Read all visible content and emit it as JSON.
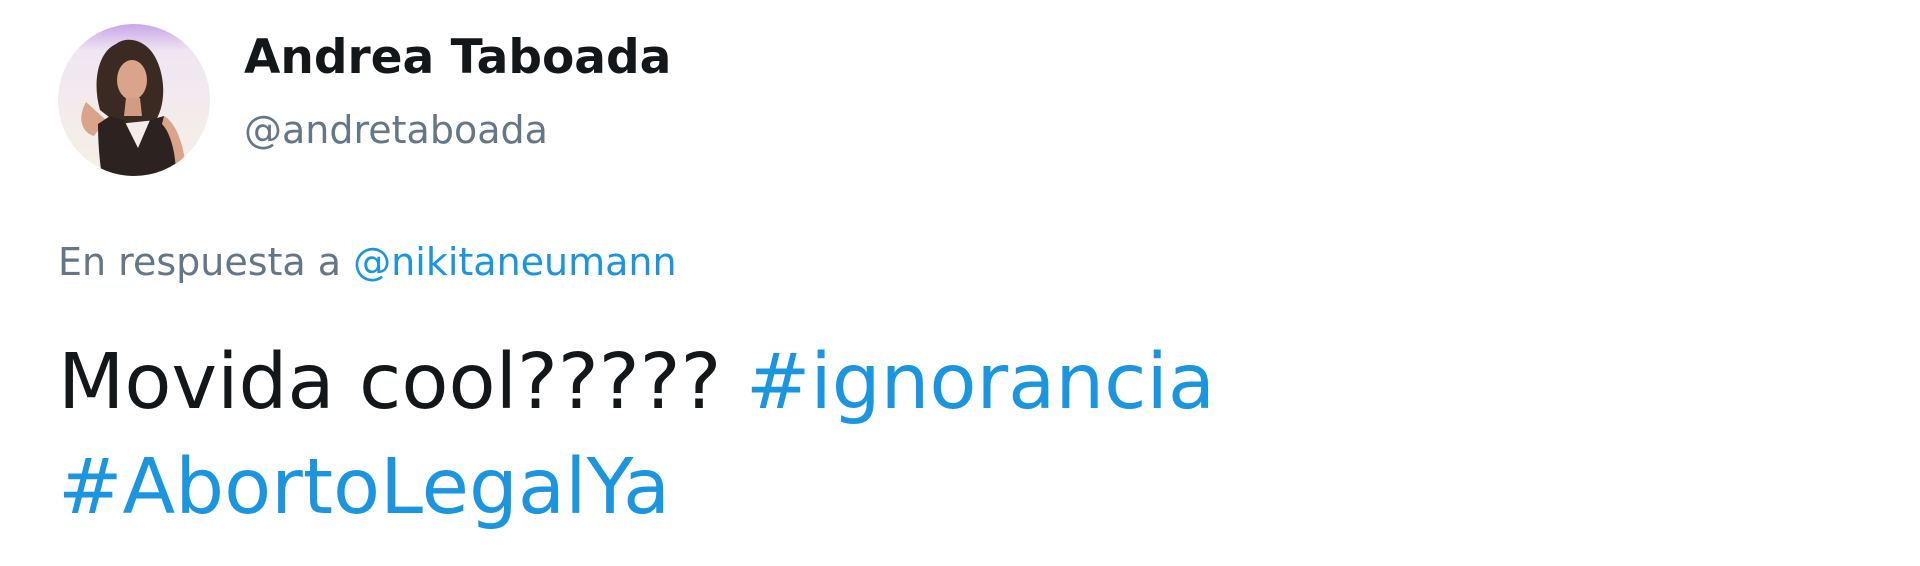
{
  "author": {
    "display_name": "Andrea Taboada",
    "handle": "@andretaboada"
  },
  "reply": {
    "prefix": "En respuesta a",
    "mention": "@nikitaneumann"
  },
  "tweet": {
    "text": "Movida cool?????",
    "hashtags": [
      "#ignorancia",
      "#AbortoLegalYa"
    ]
  },
  "colors": {
    "link": "#1b95e0",
    "secondary_text": "#657786",
    "primary_text": "#14171a"
  }
}
